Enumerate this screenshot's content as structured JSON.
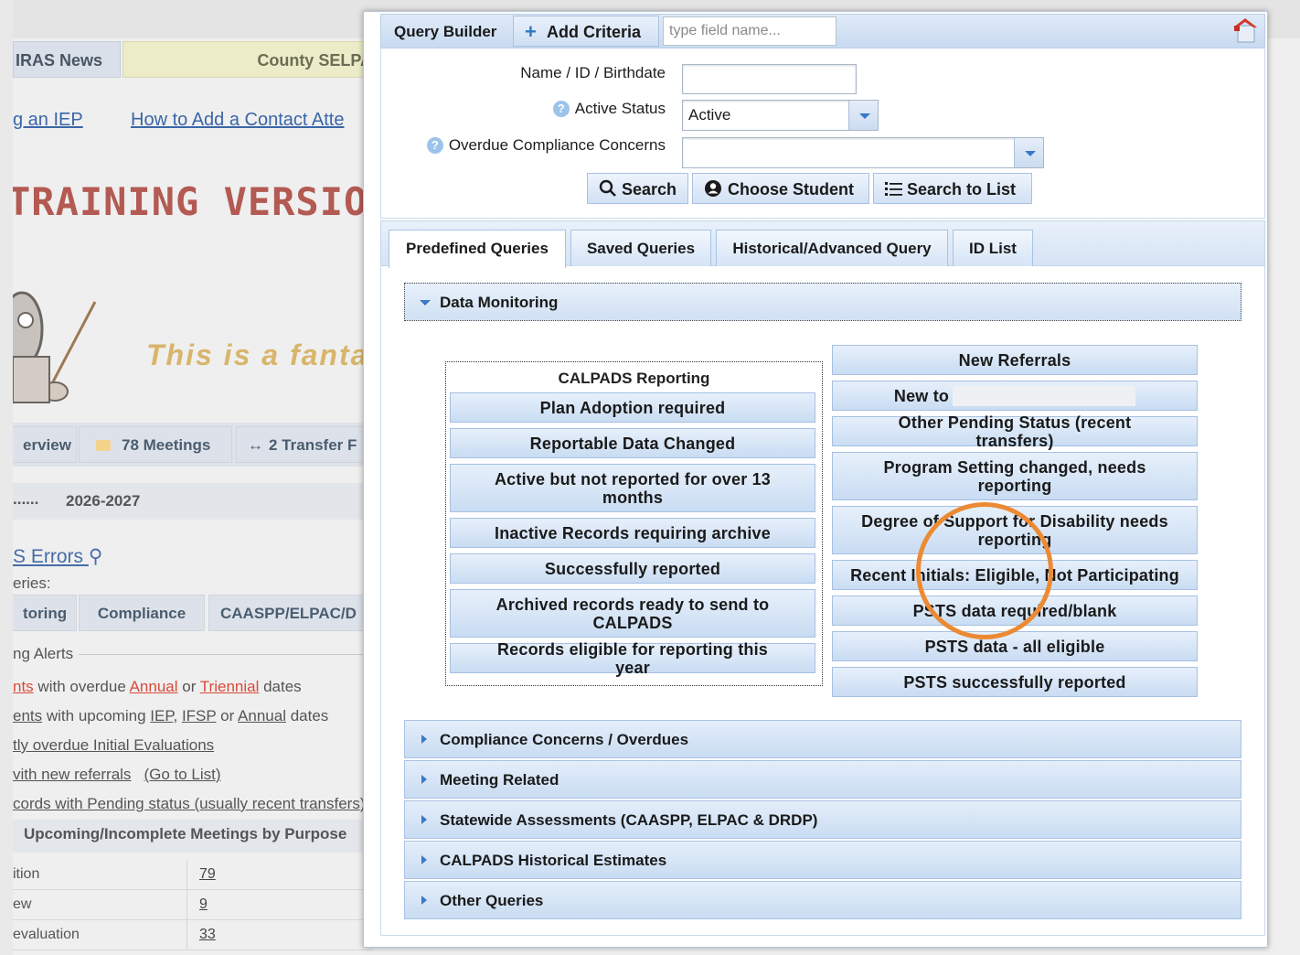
{
  "background": {
    "top_tabs": [
      "IRAS News",
      "County SELPA"
    ],
    "links": [
      "g an IEP",
      "How to Add a Contact Atte"
    ],
    "banner": "TRAINING VERSION",
    "tagline": "This is a fantas",
    "sub_tabs": [
      "erview",
      "78 Meetings",
      "2 Transfer F"
    ],
    "school_year_prefix": "......",
    "school_year": "2026-2027",
    "errors_title": "S Errors",
    "queries_label": "eries:",
    "mini_tabs": [
      "toring",
      "Compliance",
      "CAASPP/ELPAC/D"
    ],
    "alerts_label": "ng Alerts",
    "alert_lines": {
      "l1_a": "nts",
      "l1_b": " with overdue ",
      "l1_c": "Annual",
      "l1_d": " or ",
      "l1_e": "Triennial",
      "l1_f": " dates",
      "l2_a": "ents",
      "l2_b": " with upcoming ",
      "l2_c": "IEP",
      "l2_d": ", ",
      "l2_e": "IFSP",
      "l2_f": " or ",
      "l2_g": "Annual",
      "l2_h": " dates",
      "l3": "tly overdue Initial Evaluations",
      "l4_a": "vith new referrals",
      "l4_b": "(Go to List)",
      "l5": "cords with Pending status (usually recent transfers)"
    },
    "meetings_header": "Upcoming/Incomplete Meetings by Purpose",
    "meeting_rows": [
      {
        "label": "ition",
        "count": "79"
      },
      {
        "label": "ew",
        "count": "9"
      },
      {
        "label": "evaluation",
        "count": "33"
      }
    ]
  },
  "modal": {
    "toolbar": {
      "title": "Query Builder",
      "add_criteria": "Add Criteria",
      "field_placeholder": "type field name..."
    },
    "form": {
      "name_label": "Name / ID / Birthdate",
      "name_value": "",
      "status_label": "Active Status",
      "status_value": "Active",
      "overdue_label": "Overdue Compliance Concerns",
      "overdue_value": "",
      "search": "Search",
      "choose_student": "Choose Student",
      "search_to_list": "Search to List"
    },
    "tabs": [
      "Predefined Queries",
      "Saved Queries",
      "Historical/Advanced Query",
      "ID List"
    ],
    "open_section": "Data Monitoring",
    "calpads": {
      "title": "CALPADS Reporting",
      "items": [
        "Plan Adoption required",
        "Reportable Data Changed",
        "Active but not reported for over 13 months",
        "Inactive Records requiring archive",
        "Successfully reported",
        "Archived records ready to send to CALPADS",
        "Records eligible for reporting this year"
      ]
    },
    "right_items": [
      "New Referrals",
      "New to",
      "Other Pending Status (recent transfers)",
      "Program Setting changed, needs reporting",
      "Degree of Support for Disability needs reporting",
      "Recent Initials: Eligible, Not Participating",
      "PSTS data required/blank",
      "PSTS data - all eligible",
      "PSTS successfully reported"
    ],
    "sections": [
      "Compliance Concerns / Overdues",
      "Meeting Related",
      "Statewide Assessments (CAASPP, ELPAC & DRDP)",
      "CALPADS Historical Estimates",
      "Other Queries"
    ]
  }
}
